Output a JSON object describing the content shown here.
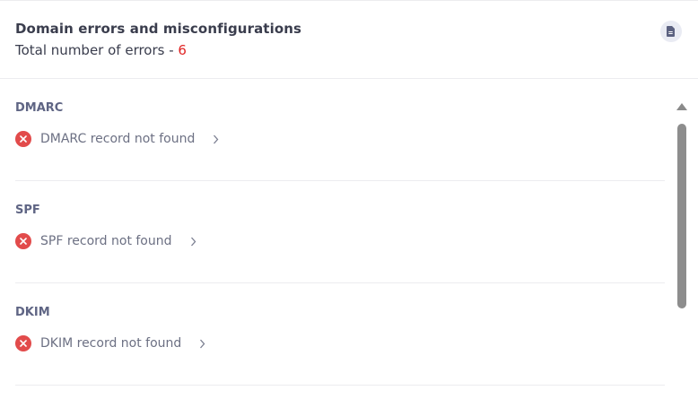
{
  "header": {
    "title": "Domain errors and misconfigurations",
    "subtitle_prefix": "Total number of errors - ",
    "error_count": "6",
    "report_icon": "document-icon"
  },
  "sections": [
    {
      "title": "DMARC",
      "error": "DMARC record not found"
    },
    {
      "title": "SPF",
      "error": "SPF record not found"
    },
    {
      "title": "DKIM",
      "error": "DKIM record not found"
    }
  ],
  "colors": {
    "error": "#e24b4b",
    "count": "#e02424",
    "section_title": "#5f6584"
  }
}
